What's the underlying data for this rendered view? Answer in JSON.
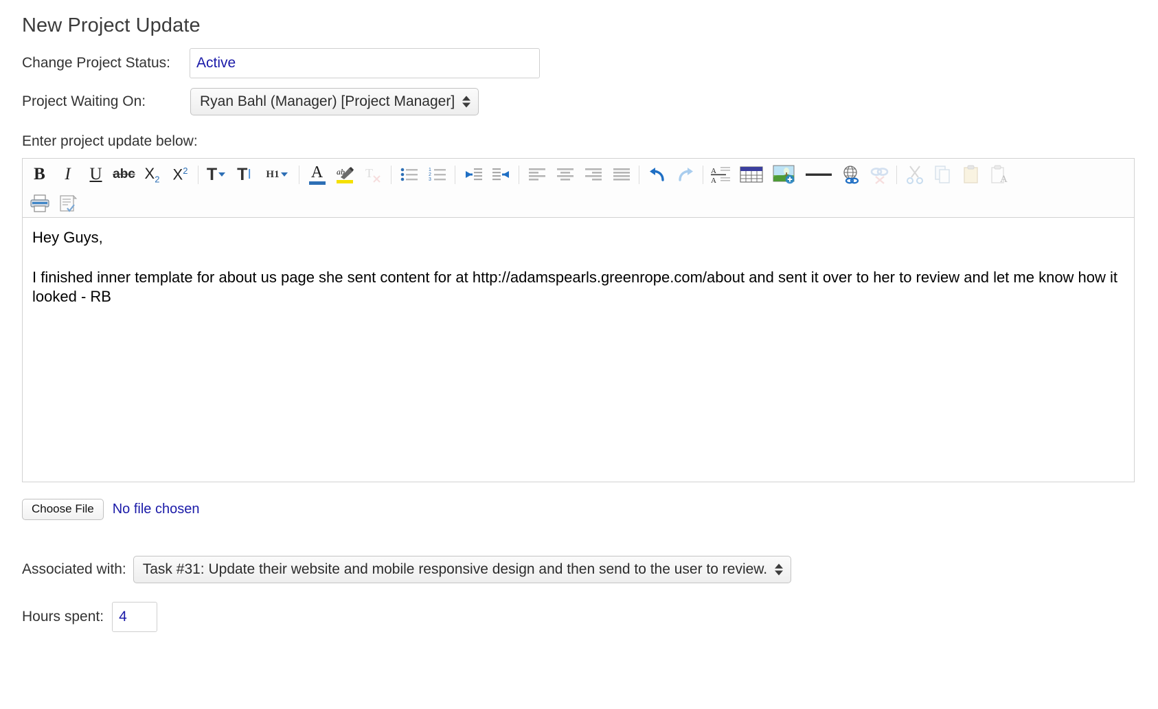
{
  "page": {
    "title": "New Project Update"
  },
  "status_field": {
    "label": "Change Project Status:",
    "value": "Active",
    "placeholder": ""
  },
  "waiting_field": {
    "label": "Project Waiting On:",
    "value": "Ryan Bahl (Manager) [Project Manager]"
  },
  "editor": {
    "instruction": "Enter project update below:",
    "toolbar": {
      "row1": [
        {
          "name": "bold-icon",
          "label": "B"
        },
        {
          "name": "italic-icon",
          "label": "I"
        },
        {
          "name": "underline-icon",
          "label": "U"
        },
        {
          "name": "strikethrough-icon",
          "label": "abc"
        },
        {
          "name": "subscript-icon",
          "label": "X"
        },
        {
          "name": "superscript-icon",
          "label": "X"
        },
        {
          "name": "font-family-icon",
          "label": "T"
        },
        {
          "name": "font-size-icon",
          "label": "T"
        },
        {
          "name": "heading-icon",
          "label": "H1"
        },
        {
          "name": "text-color-icon",
          "label": "A"
        },
        {
          "name": "highlight-color-icon",
          "label": "ab"
        },
        {
          "name": "remove-format-icon",
          "label": "T"
        },
        {
          "name": "bullet-list-icon",
          "label": ""
        },
        {
          "name": "numbered-list-icon",
          "label": ""
        },
        {
          "name": "outdent-icon",
          "label": ""
        },
        {
          "name": "indent-icon",
          "label": ""
        },
        {
          "name": "align-left-icon",
          "label": ""
        },
        {
          "name": "align-center-icon",
          "label": ""
        },
        {
          "name": "align-right-icon",
          "label": ""
        },
        {
          "name": "align-justify-icon",
          "label": ""
        },
        {
          "name": "undo-icon",
          "label": ""
        },
        {
          "name": "redo-icon",
          "label": ""
        },
        {
          "name": "line-spacing-icon",
          "label": ""
        },
        {
          "name": "insert-table-icon",
          "label": ""
        },
        {
          "name": "insert-image-icon",
          "label": ""
        },
        {
          "name": "horizontal-rule-icon",
          "label": ""
        },
        {
          "name": "insert-link-icon",
          "label": ""
        },
        {
          "name": "unlink-icon",
          "label": ""
        },
        {
          "name": "cut-icon",
          "label": ""
        },
        {
          "name": "copy-icon",
          "label": ""
        },
        {
          "name": "paste-icon",
          "label": ""
        },
        {
          "name": "paste-as-text-icon",
          "label": "A"
        }
      ],
      "row2": [
        {
          "name": "print-icon",
          "label": ""
        },
        {
          "name": "spellcheck-icon",
          "label": ""
        }
      ]
    },
    "content": {
      "greeting": "Hey Guys,",
      "paragraph": "I finished inner template for about us page she sent content for at http://adamspearls.greenrope.com/about and sent it over to her to review and let me know how it looked - RB"
    }
  },
  "file_upload": {
    "button_label": "Choose File",
    "status_text": "No file chosen"
  },
  "associated_field": {
    "label": "Associated with:",
    "value": "Task #31: Update their website and mobile responsive design and then send to the user to review."
  },
  "hours_field": {
    "label": "Hours spent:",
    "value": "4"
  },
  "colors": {
    "link_blue": "#1a1aa8",
    "accent_blue": "#2d6fb5",
    "highlight_yellow": "#f5e000",
    "border_grey": "#d2d2d2"
  }
}
